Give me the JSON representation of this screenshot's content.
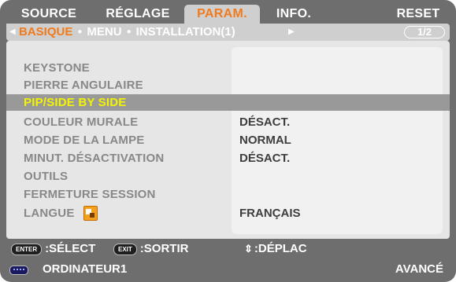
{
  "tabs": [
    {
      "label": "SOURCE",
      "active": false
    },
    {
      "label": "RÉGLAGE",
      "active": false
    },
    {
      "label": "PARAM.",
      "active": true
    },
    {
      "label": "INFO.",
      "active": false
    },
    {
      "label": "RESET",
      "active": false
    }
  ],
  "subtabs": {
    "items": [
      "BASIQUE",
      "MENU",
      "INSTALLATION(1)"
    ],
    "selected": "BASIQUE",
    "page_indicator": "1/2"
  },
  "menu": {
    "rows": [
      {
        "label": "KEYSTONE",
        "value": ""
      },
      {
        "label": "PIERRE ANGULAIRE",
        "value": ""
      },
      {
        "label": "PIP/SIDE BY SIDE",
        "value": "",
        "selected": true
      },
      {
        "label": "COULEUR MURALE",
        "value": "DÉSACT."
      },
      {
        "label": "MODE DE LA LAMPE",
        "value": "NORMAL"
      },
      {
        "label": "MINUT. DÉSACTIVATION",
        "value": "DÉSACT."
      },
      {
        "label": "OUTILS",
        "value": ""
      },
      {
        "label": "FERMETURE SESSION",
        "value": ""
      },
      {
        "label": "LANGUE",
        "value": "FRANÇAIS",
        "icon": "language-icon"
      }
    ]
  },
  "help": {
    "enter_key": "ENTER",
    "select_label": ":SÉLECT",
    "exit_key": "EXIT",
    "exit_label": ":SORTIR",
    "move_symbol": "⇕",
    "move_label": ":DÉPLAC"
  },
  "status": {
    "source_icon": "computer-input-icon",
    "source": "ORDINATEUR1",
    "mode": "AVANCÉ"
  },
  "colors": {
    "background": "#6e6e6e",
    "panel": "#e6e6e6",
    "active_tab_text": "#f07a1c",
    "selected_row_bg": "#999999",
    "selected_row_text": "#f4f400",
    "label_text": "#888888",
    "value_text": "#3e3e3e"
  }
}
